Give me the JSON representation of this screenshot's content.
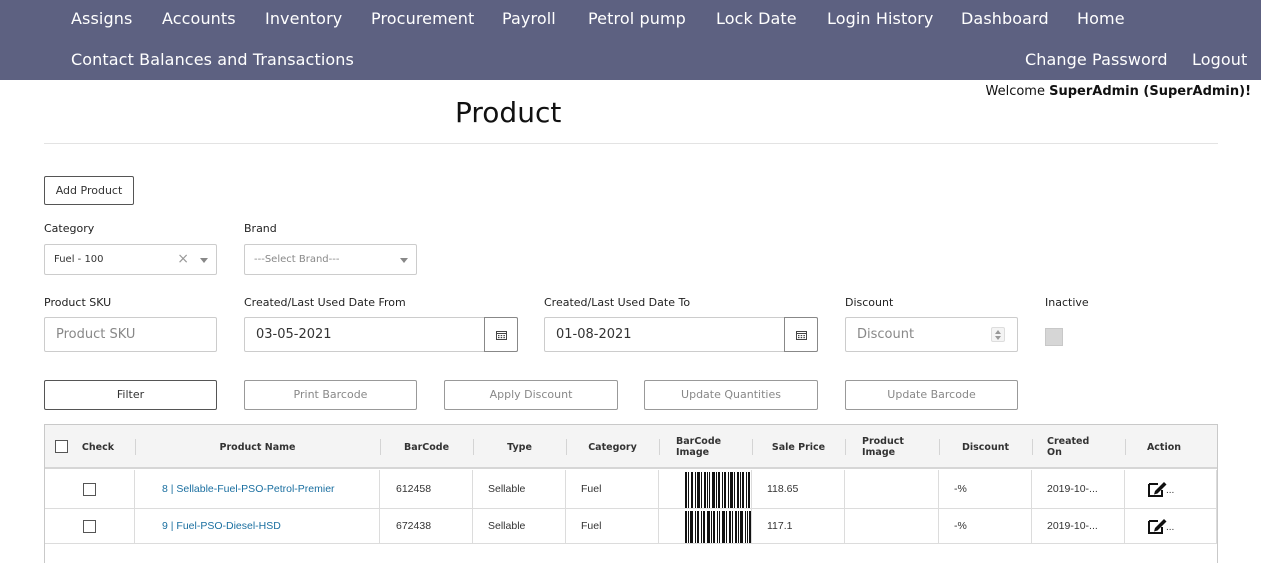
{
  "nav": {
    "row1": [
      "Assigns",
      "Accounts",
      "Inventory",
      "Procurement",
      "Payroll",
      "Petrol pump",
      "Lock Date",
      "Login History",
      "Dashboard",
      "Home"
    ],
    "row2_left": "Contact Balances and Transactions",
    "change_password": "Change Password",
    "logout": "Logout"
  },
  "welcome": {
    "prefix": "Welcome ",
    "user": "SuperAdmin (SuperAdmin)!"
  },
  "page": {
    "title": "Product"
  },
  "buttons": {
    "add_product": "Add Product",
    "filter": "Filter",
    "print_barcode": "Print Barcode",
    "apply_discount": "Apply Discount",
    "update_quantities": "Update Quantities",
    "update_barcode": "Update Barcode"
  },
  "filters": {
    "category_label": "Category",
    "category_value": "Fuel - 100",
    "brand_label": "Brand",
    "brand_placeholder": "---Select Brand---",
    "sku_label": "Product SKU",
    "sku_placeholder": "Product SKU",
    "date_from_label": "Created/Last Used Date From",
    "date_from_value": "03-05-2021",
    "date_to_label": "Created/Last Used Date To",
    "date_to_value": "01-08-2021",
    "discount_label": "Discount",
    "discount_placeholder": "Discount",
    "inactive_label": "Inactive"
  },
  "table": {
    "headers": [
      "Check",
      "Product Name",
      "BarCode",
      "Type",
      "Category",
      "BarCode Image",
      "Sale Price",
      "Product Image",
      "Discount",
      "Created On",
      "Action"
    ],
    "rows": [
      {
        "name": "8 | Sellable-Fuel-PSO-Petrol-Premier",
        "barcode": "612458",
        "type": "Sellable",
        "category": "Fuel",
        "price": "118.65",
        "discount": "-%",
        "created": "2019-10-...",
        "action_more": "..."
      },
      {
        "name": "9 | Fuel-PSO-Diesel-HSD",
        "barcode": "672438",
        "type": "Sellable",
        "category": "Fuel",
        "price": "117.1",
        "discount": "-%",
        "created": "2019-10-...",
        "action_more": "..."
      }
    ]
  },
  "colors": {
    "navbar": "#5d6181",
    "link": "#1a6fa0"
  }
}
